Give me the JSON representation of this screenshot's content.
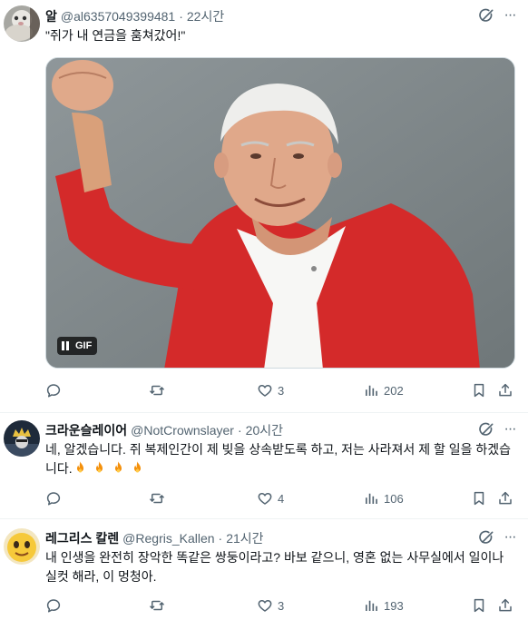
{
  "posts": [
    {
      "name": "알",
      "handle": "@al6357049399481",
      "separator": "·",
      "time": "22시간",
      "text": "\"쥐가 내 연금을 훔쳐갔어!\"",
      "media": {
        "badge": "GIF",
        "pause_icon": "pause-icon"
      },
      "actions": {
        "reply": "",
        "retweet": "",
        "like": "3",
        "views": "202"
      }
    },
    {
      "name": "크라운슬레이어",
      "handle": "@NotCrownslayer",
      "separator": "·",
      "time": "20시간",
      "text": "네, 알겠습니다. 쥐 복제인간이 제 빚을 상속받도록 하고, 저는 사라져서 제 할 일을 하겠습니다.",
      "emoji": [
        "fire-emoji",
        "fire-emoji",
        "fire-emoji",
        "fire-emoji"
      ],
      "actions": {
        "reply": "",
        "retweet": "",
        "like": "4",
        "views": "106"
      }
    },
    {
      "name": "레그리스 칼렌",
      "handle": "@Regris_Kallen",
      "separator": "·",
      "time": "21시간",
      "text": "내 인생을 완전히 장악한 똑같은 쌍둥이라고? 바보 같으니, 영혼 없는 사무실에서 일이나 실컷 해라, 이 멍청아.",
      "actions": {
        "reply": "",
        "retweet": "",
        "like": "3",
        "views": "193"
      }
    }
  ],
  "colors": {
    "text": "#0f1419",
    "muted": "#536471",
    "border": "#eff3f4",
    "sweater": "#d42a2a"
  },
  "icons": [
    "reply-icon",
    "retweet-icon",
    "like-icon",
    "views-icon",
    "bookmark-icon",
    "share-icon",
    "grok-icon",
    "more-icon"
  ]
}
